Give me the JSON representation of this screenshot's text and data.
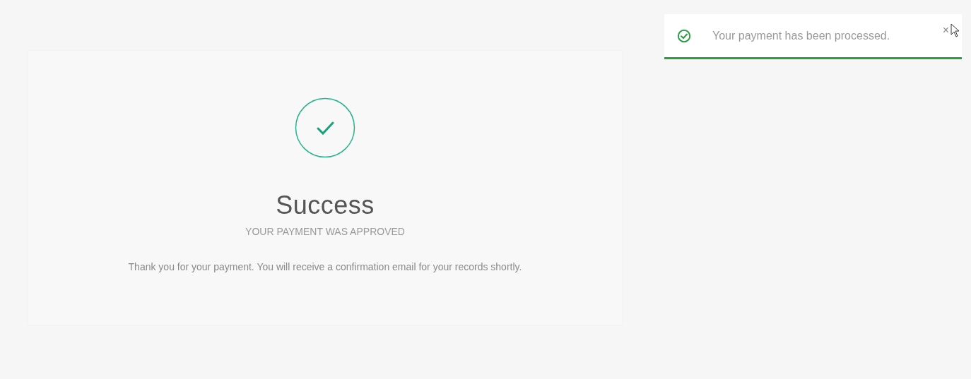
{
  "card": {
    "title": "Success",
    "subtitle": "YOUR PAYMENT WAS APPROVED",
    "message": "Thank you for your payment. You will receive a confirmation email for your records shortly."
  },
  "toast": {
    "message": "Your payment has been processed.",
    "close": "×"
  }
}
